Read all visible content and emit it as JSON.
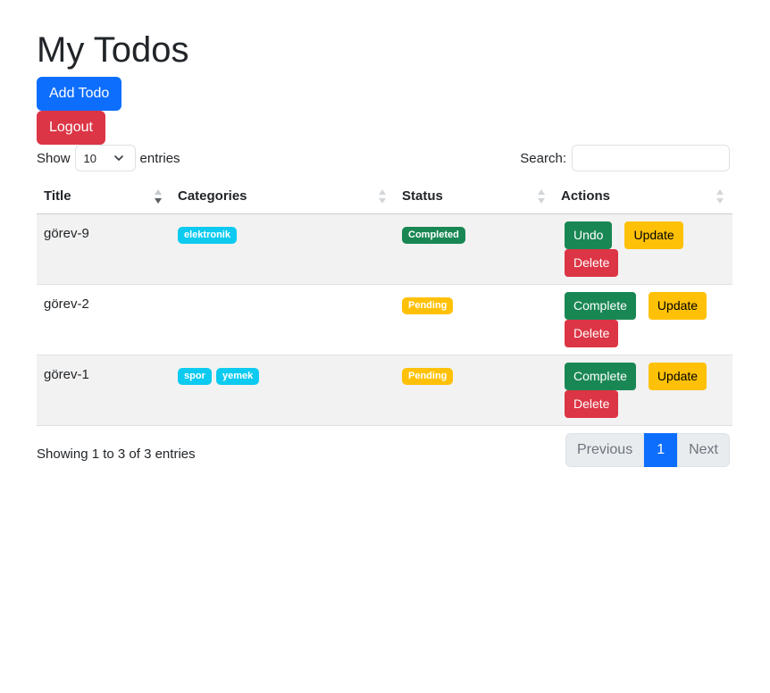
{
  "header": {
    "title": "My Todos",
    "add_label": "Add Todo",
    "logout_label": "Logout"
  },
  "length": {
    "prefix": "Show",
    "value": "10",
    "suffix": "entries"
  },
  "search": {
    "label": "Search:",
    "value": ""
  },
  "table": {
    "columns": [
      "Title",
      "Categories",
      "Status",
      "Actions"
    ],
    "rows": [
      {
        "title": "görev-9",
        "categories": [
          "elektronik"
        ],
        "status": "Completed",
        "primary_action": "Undo",
        "update_label": "Update",
        "delete_label": "Delete"
      },
      {
        "title": "görev-2",
        "categories": [],
        "status": "Pending",
        "primary_action": "Complete",
        "update_label": "Update",
        "delete_label": "Delete"
      },
      {
        "title": "görev-1",
        "categories": [
          "spor",
          "yemek"
        ],
        "status": "Pending",
        "primary_action": "Complete",
        "update_label": "Update",
        "delete_label": "Delete"
      }
    ]
  },
  "footer": {
    "info": "Showing 1 to 3 of 3 entries",
    "previous_label": "Previous",
    "current_page": "1",
    "next_label": "Next"
  },
  "colors": {
    "primary": "#0d6efd",
    "danger": "#dc3545",
    "success": "#198754",
    "warning": "#ffc107",
    "info": "#0dcaf0"
  }
}
